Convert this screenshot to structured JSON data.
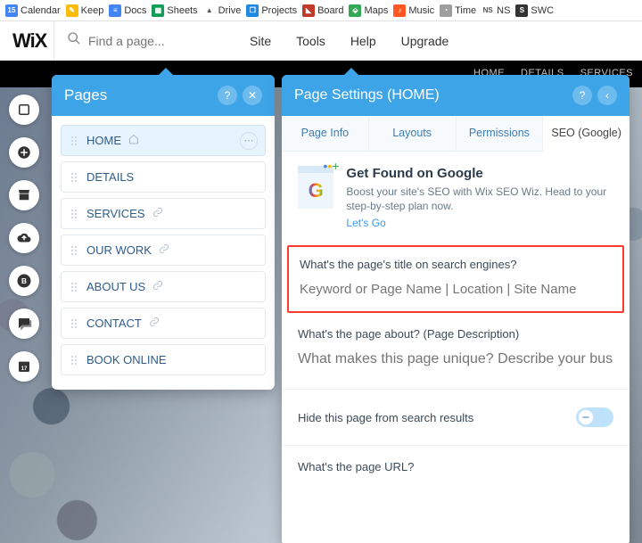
{
  "bookmarks": [
    {
      "label": "Calendar",
      "bg": "#4285f4",
      "glyph": "15"
    },
    {
      "label": "Keep",
      "bg": "#fbbc05",
      "glyph": "✎"
    },
    {
      "label": "Docs",
      "bg": "#4285f4",
      "glyph": "≡"
    },
    {
      "label": "Sheets",
      "bg": "#0f9d58",
      "glyph": "▦"
    },
    {
      "label": "Drive",
      "bg": "#ffffff",
      "glyph": "▲"
    },
    {
      "label": "Projects",
      "bg": "#1e88e5",
      "glyph": "❐"
    },
    {
      "label": "Board",
      "bg": "#c0392b",
      "glyph": "◣"
    },
    {
      "label": "Maps",
      "bg": "#34a853",
      "glyph": "⬙"
    },
    {
      "label": "Music",
      "bg": "#ff5722",
      "glyph": "♪"
    },
    {
      "label": "Time",
      "bg": "#9e9e9e",
      "glyph": "◔"
    },
    {
      "label": "NS",
      "bg": "#ffffff",
      "glyph": "NS"
    },
    {
      "label": "SWC",
      "bg": "#333333",
      "glyph": "S"
    }
  ],
  "wix": {
    "logo": "WiX",
    "search_placeholder": "Find a page...",
    "menu": [
      "Site",
      "Tools",
      "Help",
      "Upgrade"
    ]
  },
  "site_nav": [
    "HOME",
    "DETAILS",
    "SERVICES"
  ],
  "pages_panel": {
    "title": "Pages",
    "items": [
      {
        "label": "HOME",
        "home": true,
        "selected": true,
        "more": true
      },
      {
        "label": "DETAILS"
      },
      {
        "label": "SERVICES",
        "link": true
      },
      {
        "label": "OUR WORK",
        "link": true
      },
      {
        "label": "ABOUT US",
        "link": true
      },
      {
        "label": "CONTACT",
        "link": true
      },
      {
        "label": "BOOK ONLINE"
      }
    ]
  },
  "settings": {
    "title": "Page Settings (HOME)",
    "tabs": [
      "Page Info",
      "Layouts",
      "Permissions",
      "SEO (Google)"
    ],
    "active_tab": 3,
    "promo": {
      "heading": "Get Found on Google",
      "body": "Boost your site's SEO with Wix SEO Wiz. Head to your step-by-step plan now.",
      "cta": "Let's Go"
    },
    "title_field": {
      "label": "What's the page's title on search engines?",
      "placeholder": "Keyword or Page Name | Location | Site Name"
    },
    "desc_field": {
      "label": "What's the page about? (Page Description)",
      "placeholder": "What makes this page unique? Describe your business and the content on your site..."
    },
    "hide_row": {
      "label": "Hide this page from search results"
    },
    "url_row": {
      "label": "What's the page URL?"
    }
  }
}
